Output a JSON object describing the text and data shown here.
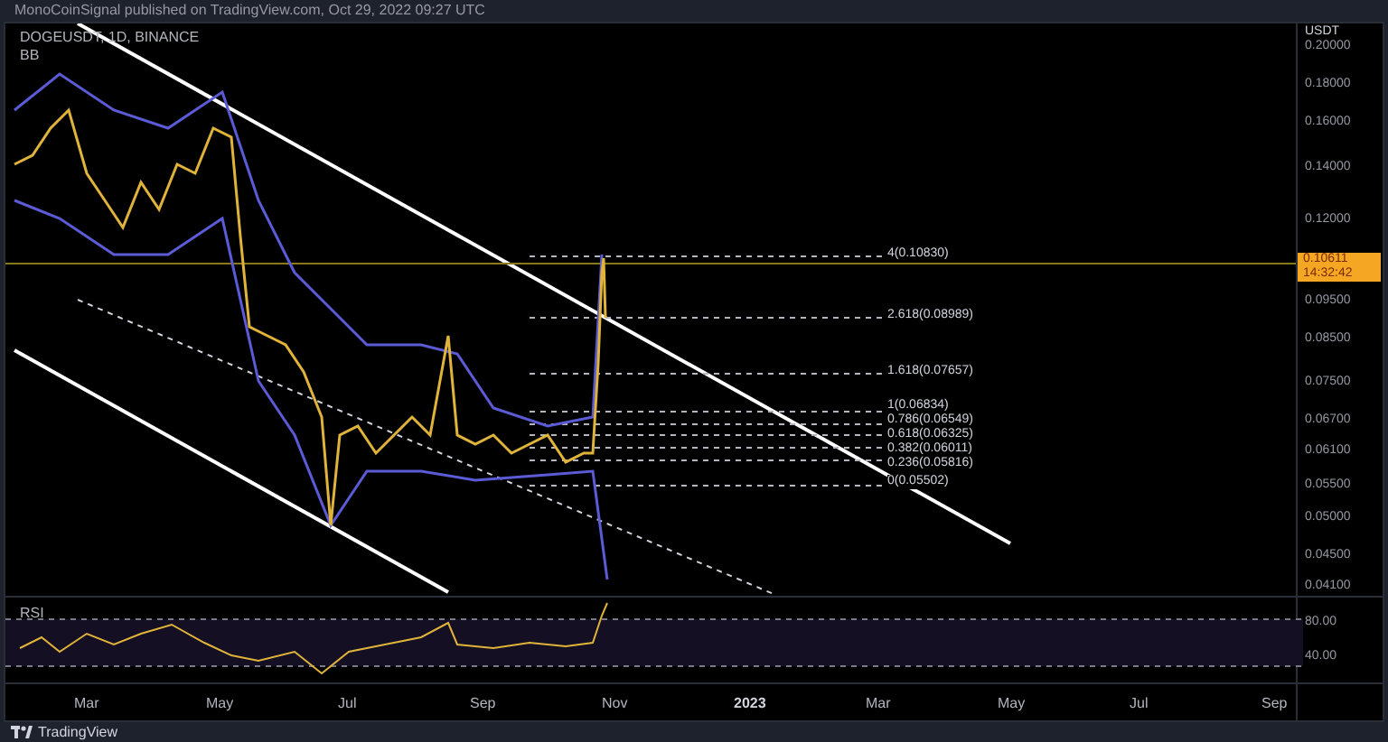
{
  "header": {
    "text": "MonoCoinSignal published on TradingView.com, Oct 29, 2022 09:27 UTC"
  },
  "chart": {
    "symbol": "DOGEUSDT, 1D, BINANCE",
    "indicator": "BB",
    "fib_levels": [
      {
        "label": "4(0.10830)"
      },
      {
        "label": "2.618(0.08989)"
      },
      {
        "label": "1.618(0.07657)"
      },
      {
        "label": "1(0.06834)"
      },
      {
        "label": "0.786(0.06549)"
      },
      {
        "label": "0.618(0.06325)"
      },
      {
        "label": "0.382(0.06011)"
      },
      {
        "label": "0.236(0.05816)"
      },
      {
        "label": "0(0.05502)"
      }
    ],
    "price_badge": {
      "price": "0.10611",
      "countdown": "14:32:42"
    }
  },
  "price_axis": {
    "currency": "USDT",
    "labels": [
      "0.20000",
      "0.18000",
      "0.16000",
      "0.14000",
      "0.12000",
      "0.09500",
      "0.08500",
      "0.07500",
      "0.06700",
      "0.06100",
      "0.05500",
      "0.05000",
      "0.04500",
      "0.04100"
    ]
  },
  "rsi": {
    "label": "RSI",
    "axis_labels": [
      "80.00",
      "40.00"
    ]
  },
  "time_axis": [
    {
      "label": "Mar",
      "kind": "month"
    },
    {
      "label": "May",
      "kind": "month"
    },
    {
      "label": "Jul",
      "kind": "month"
    },
    {
      "label": "Sep",
      "kind": "month"
    },
    {
      "label": "Nov",
      "kind": "month"
    },
    {
      "label": "2023",
      "kind": "year"
    },
    {
      "label": "Mar",
      "kind": "month"
    },
    {
      "label": "May",
      "kind": "month"
    },
    {
      "label": "Jul",
      "kind": "month"
    },
    {
      "label": "Sep",
      "kind": "month"
    }
  ],
  "footer": {
    "brand": "TradingView"
  }
}
